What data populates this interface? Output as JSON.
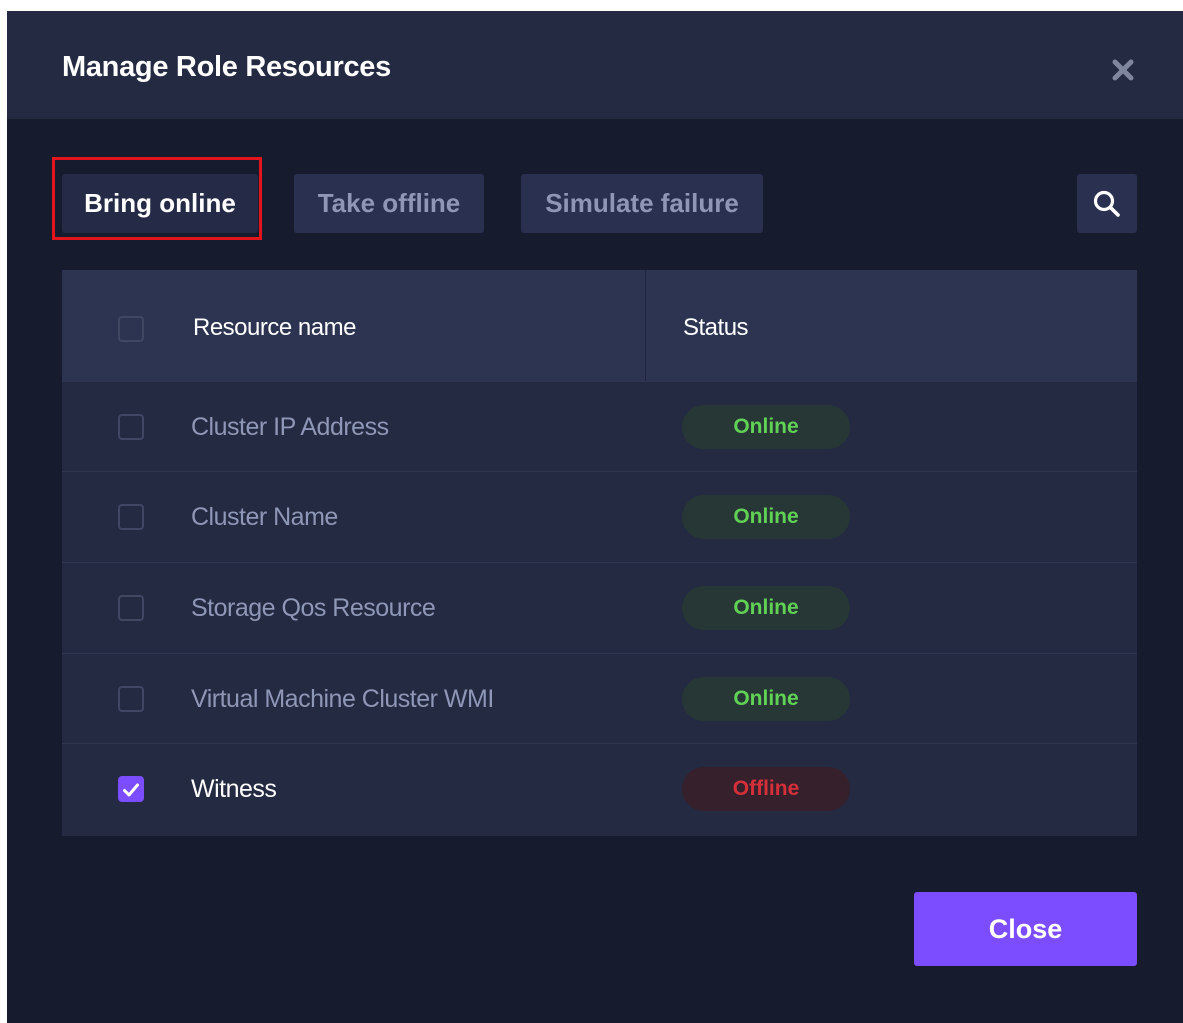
{
  "dialog": {
    "title": "Manage Role Resources",
    "close_icon": "close-icon"
  },
  "toolbar": {
    "bring_online_label": "Bring online",
    "take_offline_label": "Take offline",
    "simulate_failure_label": "Simulate failure",
    "search_icon": "search-icon"
  },
  "table": {
    "headers": {
      "resource_name": "Resource name",
      "status": "Status"
    },
    "rows": [
      {
        "name": "Cluster IP Address",
        "status": "Online",
        "checked": false
      },
      {
        "name": "Cluster Name",
        "status": "Online",
        "checked": false
      },
      {
        "name": "Storage Qos Resource",
        "status": "Online",
        "checked": false
      },
      {
        "name": "Virtual Machine Cluster WMI",
        "status": "Online",
        "checked": false
      },
      {
        "name": "Witness",
        "status": "Offline",
        "checked": true
      }
    ]
  },
  "footer": {
    "close_label": "Close"
  },
  "colors": {
    "accent": "#7c4dff",
    "online": "#61d155",
    "offline": "#d5303a",
    "highlight": "#e3141b"
  }
}
